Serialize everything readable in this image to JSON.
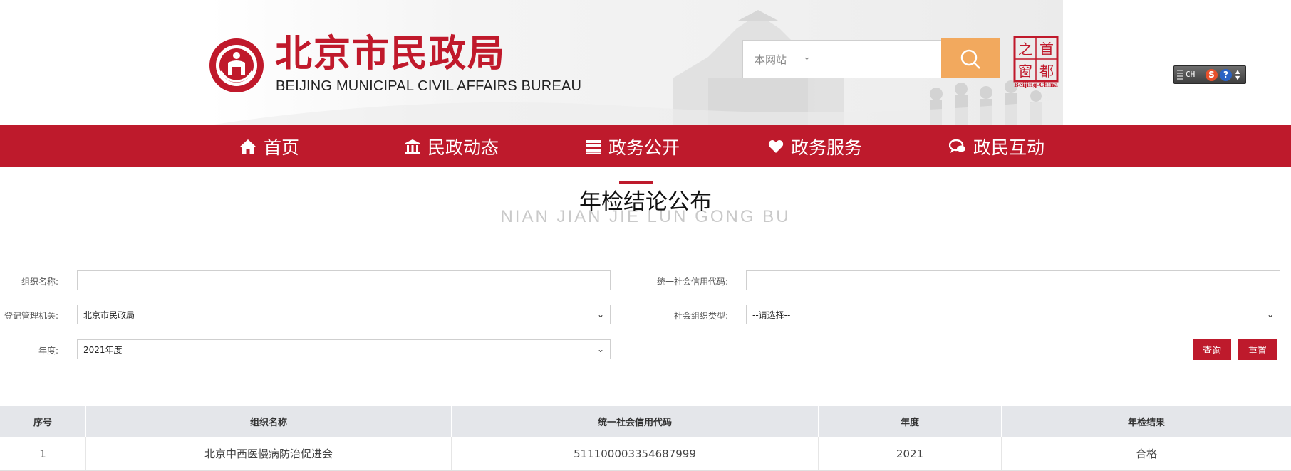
{
  "header": {
    "logo_title": "北京市民政局",
    "logo_subtitle": "BEIJING MUNICIPAL CIVIL AFFAIRS BUREAU",
    "search_scope": "本网站",
    "capital_window_chars": [
      "首",
      "之",
      "都",
      "窗"
    ],
    "capital_window_caption": "Beijing-China",
    "toolbar_text": "CH",
    "colors": {
      "brand_red": "#be1a2c",
      "search_orange": "#f2a95e"
    }
  },
  "nav": {
    "items": [
      {
        "label": "首页",
        "icon": "home-icon"
      },
      {
        "label": "民政动态",
        "icon": "building-icon"
      },
      {
        "label": "政务公开",
        "icon": "book-icon"
      },
      {
        "label": "政务服务",
        "icon": "heart-icon"
      },
      {
        "label": "政民互动",
        "icon": "chat-icon"
      }
    ]
  },
  "page": {
    "title": "年检结论公布",
    "subtitle": "NIAN JIAN JIE LUN GONG BU"
  },
  "form": {
    "org_name_label": "组织名称:",
    "org_name_value": "",
    "credit_code_label": "统一社会信用代码:",
    "credit_code_value": "",
    "authority_label": "登记管理机关:",
    "authority_value": "北京市民政局",
    "org_type_label": "社会组织类型:",
    "org_type_value": "--请选择--",
    "year_label": "年度:",
    "year_value": "2021年度",
    "query_button": "查询",
    "reset_button": "重置"
  },
  "table": {
    "headers": [
      "序号",
      "组织名称",
      "统一社会信用代码",
      "年度",
      "年检结果"
    ],
    "rows": [
      [
        "1",
        "北京中西医慢病防治促进会",
        "511100003354687999",
        "2021",
        "合格"
      ]
    ]
  }
}
